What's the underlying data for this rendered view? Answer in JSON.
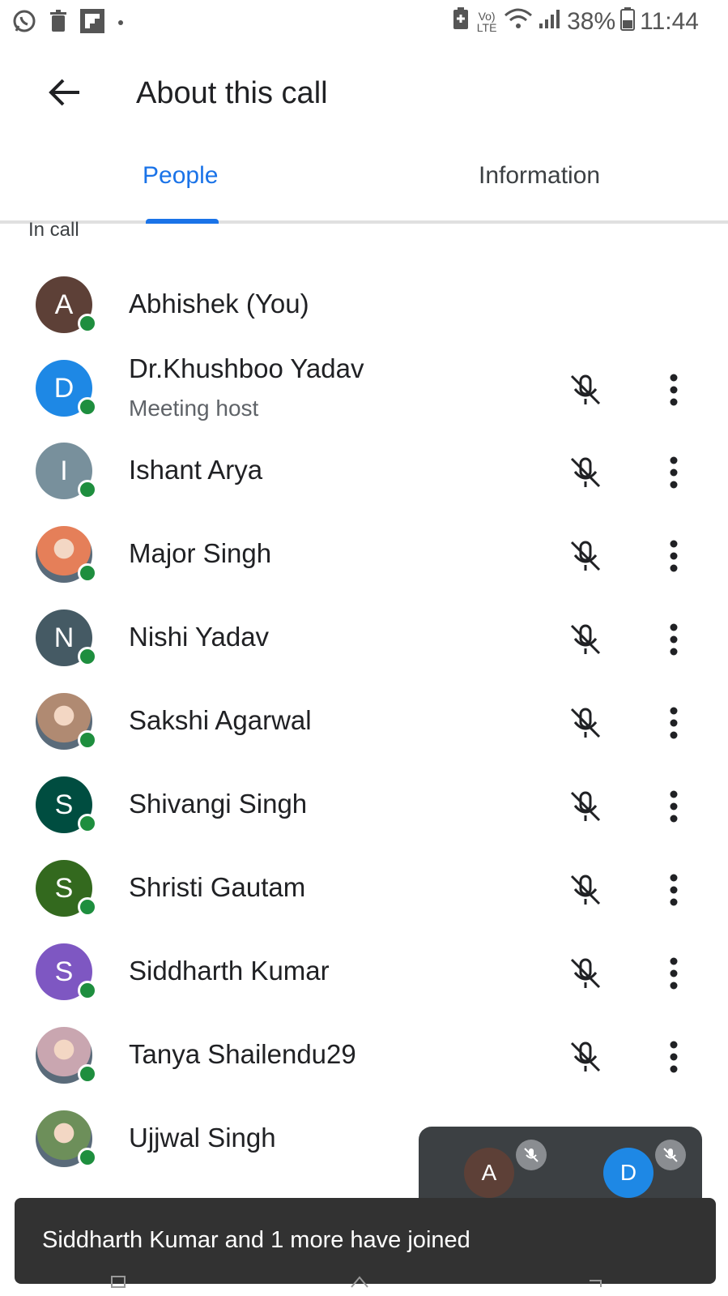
{
  "status_bar": {
    "left_icons": [
      "whatsapp-icon",
      "trash-icon",
      "flipboard-icon",
      "dot-icon"
    ],
    "network_label": "Vo) LTE",
    "battery_percent": "38%",
    "time": "11:44"
  },
  "app_bar": {
    "title": "About this call",
    "back_icon": "arrow-back-icon"
  },
  "tabs": [
    {
      "label": "People",
      "selected": true
    },
    {
      "label": "Information",
      "selected": false
    }
  ],
  "section_label": "In call",
  "participants": [
    {
      "name": "Abhishek (You)",
      "initial": "A",
      "color": "#5d4037",
      "subtitle": "",
      "muted_icon": false,
      "more": false
    },
    {
      "name": "Dr.Khushboo Yadav",
      "initial": "D",
      "color": "#1e88e5",
      "subtitle": "Meeting host",
      "muted_icon": true,
      "more": true
    },
    {
      "name": "Ishant Arya",
      "initial": "I",
      "color": "#78909c",
      "subtitle": "",
      "muted_icon": true,
      "more": true
    },
    {
      "name": "Major Singh",
      "initial": "",
      "color": "#e57f59",
      "photo": true,
      "subtitle": "",
      "muted_icon": true,
      "more": true
    },
    {
      "name": "Nishi Yadav",
      "initial": "N",
      "color": "#455a64",
      "subtitle": "",
      "muted_icon": true,
      "more": true
    },
    {
      "name": "Sakshi Agarwal",
      "initial": "",
      "color": "#b08a72",
      "photo": true,
      "subtitle": "",
      "muted_icon": true,
      "more": true
    },
    {
      "name": "Shivangi Singh",
      "initial": "S",
      "color": "#004d40",
      "subtitle": "",
      "muted_icon": true,
      "more": true
    },
    {
      "name": "Shristi Gautam",
      "initial": "S",
      "color": "#33691e",
      "subtitle": "",
      "muted_icon": true,
      "more": true
    },
    {
      "name": "Siddharth Kumar",
      "initial": "S",
      "color": "#7e57c2",
      "subtitle": "",
      "muted_icon": true,
      "more": true
    },
    {
      "name": "Tanya Shailendu29",
      "initial": "",
      "color": "#c9a6b0",
      "photo": true,
      "subtitle": "",
      "muted_icon": true,
      "more": true
    },
    {
      "name": "Ujjwal Singh",
      "initial": "",
      "color": "#6d8f5a",
      "photo": true,
      "subtitle": "",
      "muted_icon": false,
      "more": false
    }
  ],
  "mini_panel": [
    {
      "initial": "A",
      "color": "#5d4037",
      "muted": true
    },
    {
      "initial": "D",
      "color": "#1e88e5",
      "muted": true
    }
  ],
  "snackbar": {
    "text": "Siddharth Kumar and 1 more have joined"
  },
  "colors": {
    "accent": "#1a73e8",
    "online": "#1e8e3e"
  }
}
